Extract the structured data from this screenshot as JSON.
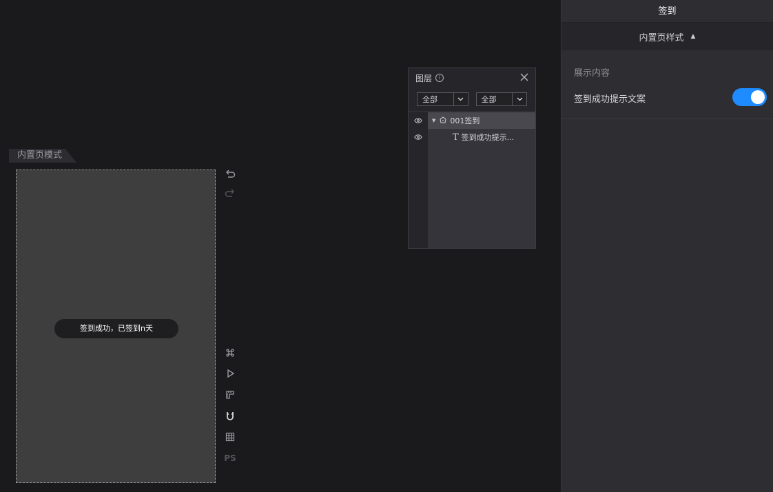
{
  "canvas": {
    "mode_tab": "内置页模式",
    "toast_text": "签到成功，已签到n天"
  },
  "toolbar": {
    "undo_icon": "undo-icon",
    "redo_icon": "redo-icon",
    "tools": [
      "command-icon",
      "play-icon",
      "ruler-icon",
      "magnet-icon",
      "grid-icon"
    ],
    "ps_label": "PS"
  },
  "layer_panel": {
    "title": "图层",
    "filter1": "全部",
    "filter2": "全部",
    "rows": [
      {
        "label": "001签到"
      },
      {
        "label": "签到成功提示..."
      }
    ]
  },
  "right_panel": {
    "title": "签到",
    "section": "内置页样式",
    "group_label": "展示内容",
    "field_label": "签到成功提示文案",
    "toggle_on": true,
    "accent_color": "#1e8cff"
  }
}
